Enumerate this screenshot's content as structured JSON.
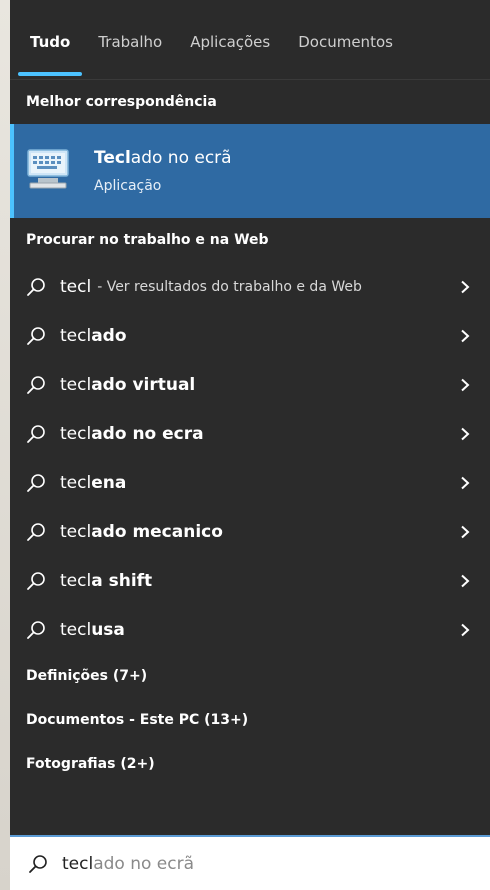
{
  "tabs": [
    {
      "label": "Tudo",
      "active": true
    },
    {
      "label": "Trabalho",
      "active": false
    },
    {
      "label": "Aplicações",
      "active": false
    },
    {
      "label": "Documentos",
      "active": false
    }
  ],
  "best_match": {
    "section_title": "Melhor correspondência",
    "title_bold": "Tecl",
    "title_rest": "ado no ecrã",
    "subtitle": "Aplicação",
    "icon": "on-screen-keyboard-icon"
  },
  "web": {
    "section_title": "Procurar no trabalho e na Web",
    "items": [
      {
        "prefix": "tecl",
        "bold": "",
        "hint": "- Ver resultados do trabalho e da Web"
      },
      {
        "prefix": "tecl",
        "bold": "ado",
        "hint": ""
      },
      {
        "prefix": "tecl",
        "bold": "ado virtual",
        "hint": ""
      },
      {
        "prefix": "tecl",
        "bold": "ado no ecra",
        "hint": ""
      },
      {
        "prefix": "tecl",
        "bold": "ena",
        "hint": ""
      },
      {
        "prefix": "tecl",
        "bold": "ado mecanico",
        "hint": ""
      },
      {
        "prefix": "tecl",
        "bold": "a shift",
        "hint": ""
      },
      {
        "prefix": "tecl",
        "bold": "usa",
        "hint": ""
      }
    ]
  },
  "sections": [
    {
      "label": "Definições (7+)"
    },
    {
      "label": "Documentos - Este PC (13+)"
    },
    {
      "label": "Fotografias (2+)"
    }
  ],
  "search": {
    "typed": "tecl",
    "completion": "ado no ecrã"
  },
  "colors": {
    "panel_bg": "#2b2b2b",
    "highlight_bg": "#2f6aa3",
    "accent": "#4cc2ff"
  }
}
